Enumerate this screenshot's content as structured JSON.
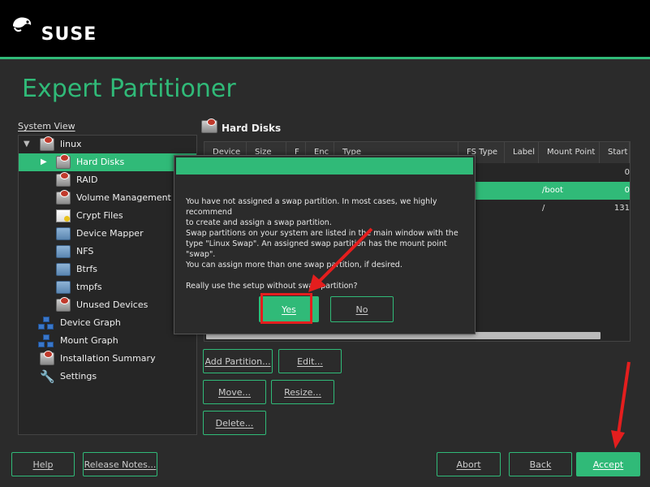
{
  "brand": {
    "name": "SUSE"
  },
  "page": {
    "title": "Expert Partitioner"
  },
  "system_view": {
    "label": "System View",
    "items": [
      {
        "label": "linux",
        "icon": "hard-disk-icon",
        "expanded": true
      },
      {
        "label": "Hard Disks",
        "icon": "hard-disk-icon",
        "selected": true
      },
      {
        "label": "RAID",
        "icon": "hard-disk-icon"
      },
      {
        "label": "Volume Management",
        "icon": "hard-disk-icon"
      },
      {
        "label": "Crypt Files",
        "icon": "certificate-icon"
      },
      {
        "label": "Device Mapper",
        "icon": "device-mapper-icon"
      },
      {
        "label": "NFS",
        "icon": "folder-icon"
      },
      {
        "label": "Btrfs",
        "icon": "folder-icon"
      },
      {
        "label": "tmpfs",
        "icon": "folder-icon"
      },
      {
        "label": "Unused Devices",
        "icon": "unused-devices-icon"
      },
      {
        "label": "Device Graph",
        "icon": "graph-icon"
      },
      {
        "label": "Mount Graph",
        "icon": "graph-icon"
      },
      {
        "label": "Installation Summary",
        "icon": "hard-disk-icon"
      },
      {
        "label": "Settings",
        "icon": "wrench-icon"
      }
    ]
  },
  "hard_disks": {
    "title": "Hard Disks",
    "columns": [
      "Device",
      "Size",
      "F",
      "Enc",
      "Type",
      "FS Type",
      "Label",
      "Mount Point",
      "Start"
    ],
    "rows": [
      {
        "mount": "",
        "start": "0"
      },
      {
        "mount": "/boot",
        "start": "0",
        "selected": true
      },
      {
        "mount": "/",
        "start": "131"
      }
    ],
    "buttons": {
      "add_partition": "Add Partition...",
      "edit": "Edit...",
      "move": "Move...",
      "resize": "Resize...",
      "delete": "Delete..."
    }
  },
  "dialog": {
    "lines_1": [
      "You have not assigned a swap partition. In most cases, we highly recommend",
      "to create and assign a swap partition.",
      "Swap partitions on your system are listed in the main window with the",
      "type \"Linux Swap\". An assigned swap partition has the mount point \"swap\".",
      "You can assign more than one swap partition, if desired."
    ],
    "question": "Really use the setup without swap partition?",
    "yes": "Yes",
    "no": "No"
  },
  "footer": {
    "help": "Help",
    "release_notes": "Release Notes...",
    "abort": "Abort",
    "back": "Back",
    "accept": "Accept"
  },
  "colors": {
    "accent": "#30ba78",
    "annotation": "#e41e1e",
    "background": "#2b2b2b",
    "topbar": "#000000"
  }
}
